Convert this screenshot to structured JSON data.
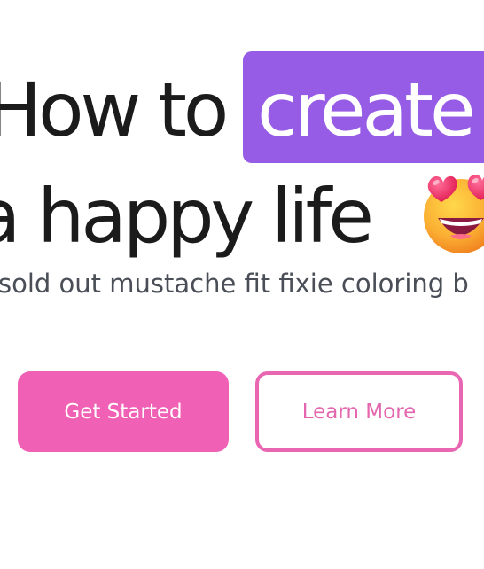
{
  "hero": {
    "headline_part1": "How to",
    "headline_highlight": "create",
    "headline_line2": "a happy life",
    "emoji_icon": "smiling-face-with-heart-eyes-icon",
    "subtitle": "sold out mustache fit fixie coloring b"
  },
  "buttons": {
    "primary_label": "Get Started",
    "secondary_label": "Learn More"
  },
  "colors": {
    "highlight": "#965ce6",
    "primary_button": "#f060b5",
    "secondary_border": "#e866b2",
    "text": "#1b1b1b",
    "subtitle_text": "#4a4f57"
  }
}
